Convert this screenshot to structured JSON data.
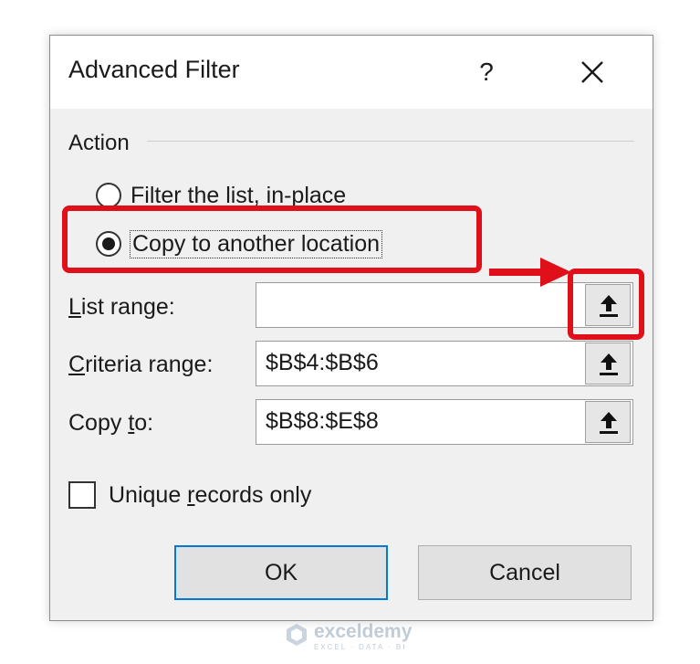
{
  "dialog": {
    "title": "Advanced Filter",
    "help_glyph": "?",
    "close_icon": "close-icon"
  },
  "action": {
    "group_label": "Action",
    "options": [
      {
        "label": "Filter the list, in-place",
        "selected": false
      },
      {
        "label": "Copy to another location",
        "selected": true
      }
    ]
  },
  "fields": {
    "list_range": {
      "label": "List range:",
      "value": ""
    },
    "criteria_range": {
      "label": "Criteria range:",
      "value": "$B$4:$B$6"
    },
    "copy_to": {
      "label": "Copy to:",
      "value": "$B$8:$E$8"
    },
    "picker_icon": "collapse-dialog-arrow-icon"
  },
  "unique_records": {
    "label": "Unique records only",
    "checked": false
  },
  "buttons": {
    "ok": "OK",
    "cancel": "Cancel"
  },
  "annotation": {
    "color": "#e0101a"
  },
  "watermark": {
    "name": "exceldemy",
    "tagline": "EXCEL · DATA · BI"
  },
  "colors": {
    "dialog_bg": "#f0f0f0",
    "default_button_border": "#0078d7"
  }
}
